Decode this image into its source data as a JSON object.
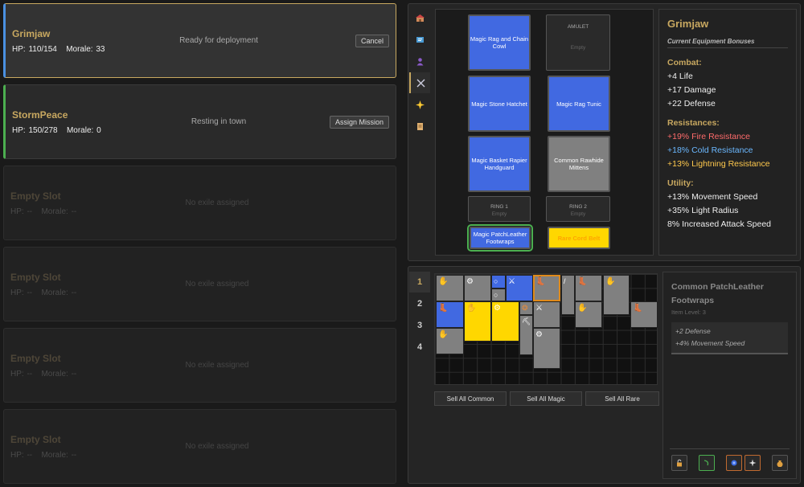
{
  "slots": [
    {
      "name": "Grimjaw",
      "hp": "HP: 110/154",
      "morale": "Morale: 33",
      "status": "Ready for deployment",
      "button": "Cancel"
    },
    {
      "name": "StormPeace",
      "hp": "HP: 150/278",
      "morale": "Morale: 0",
      "status": "Resting in town",
      "button": "Assign Mission"
    },
    {
      "name": "Empty Slot",
      "hp": "HP: --",
      "morale": "Morale: --",
      "status": "No exile assigned"
    },
    {
      "name": "Empty Slot",
      "hp": "HP: --",
      "morale": "Morale: --",
      "status": "No exile assigned"
    },
    {
      "name": "Empty Slot",
      "hp": "HP: --",
      "morale": "Morale: --",
      "status": "No exile assigned"
    },
    {
      "name": "Empty Slot",
      "hp": "HP: --",
      "morale": "Morale: --",
      "status": "No exile assigned"
    }
  ],
  "side_tabs": [
    "town-icon",
    "map-icon",
    "character-icon",
    "crossed-swords-icon",
    "sparkle-icon",
    "scroll-icon"
  ],
  "equipment": {
    "helmet": "Magic Rag and Chain Cowl",
    "amulet_label": "AMULET",
    "amulet_empty": "Empty",
    "weapon": "Magic Stone Hatchet",
    "body": "Magic Rag Tunic",
    "gloves": "Magic Basket Rapier Handguard",
    "offhand": "Common Rawhide Mittens",
    "ring1_label": "RING 1",
    "ring1_empty": "Empty",
    "ring2_label": "RING 2",
    "ring2_empty": "Empty",
    "boots": "Magic PatchLeather Footwraps",
    "belt": "Rare Cord Belt"
  },
  "bonuses": {
    "name": "Grimjaw",
    "subtitle": "Current Equipment Bonuses",
    "combat_title": "Combat:",
    "combat": [
      "+4 Life",
      "+17 Damage",
      "+22 Defense"
    ],
    "resist_title": "Resistances:",
    "fire": "+19% Fire Resistance",
    "cold": "+18% Cold Resistance",
    "lightning": "+13% Lightning Resistance",
    "utility_title": "Utility:",
    "utility": [
      "+13% Movement Speed",
      "+35% Light Radius",
      "8% Increased Attack Speed"
    ],
    "colors": {
      "fire": "#ff6b6b",
      "cold": "#6bb8ff",
      "lightning": "#ffc94d"
    }
  },
  "inventory": {
    "tabs": [
      "1",
      "2",
      "3",
      "4"
    ],
    "sell_common": "Sell All Common",
    "sell_magic": "Sell All Magic",
    "sell_rare": "Sell All Rare"
  },
  "detail": {
    "name": "Common PatchLeather Footwraps",
    "level": "Item Level: 3",
    "mods": [
      "+2 Defense",
      "+4% Movement Speed"
    ],
    "actions": [
      "lock-icon",
      "green-hook-icon",
      "blue-orb-icon",
      "sparkle-orb-icon",
      "coin-bag-icon"
    ]
  }
}
